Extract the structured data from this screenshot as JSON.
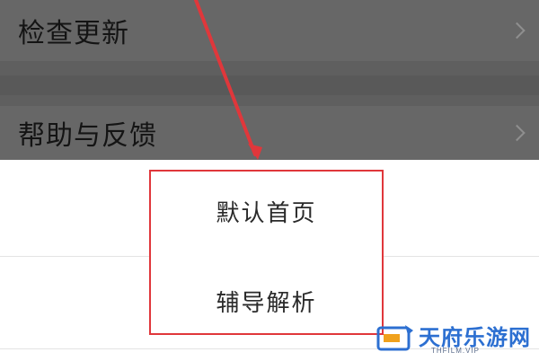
{
  "settings": {
    "items": [
      {
        "label": "检查更新"
      },
      {
        "label": "帮助与反馈"
      }
    ]
  },
  "popup": {
    "options": [
      {
        "label": "默认首页"
      },
      {
        "label": "辅导解析"
      }
    ]
  },
  "watermark": {
    "brand": "天府乐游网",
    "site": "THFILM.VIP"
  },
  "colors": {
    "highlight": "#e0373b",
    "dim_overlay": "#6b6b6b",
    "brand_blue": "#2c6fd1"
  },
  "icons": [
    "chevron-right-icon",
    "chevron-right-icon",
    "site-logo-icon"
  ]
}
